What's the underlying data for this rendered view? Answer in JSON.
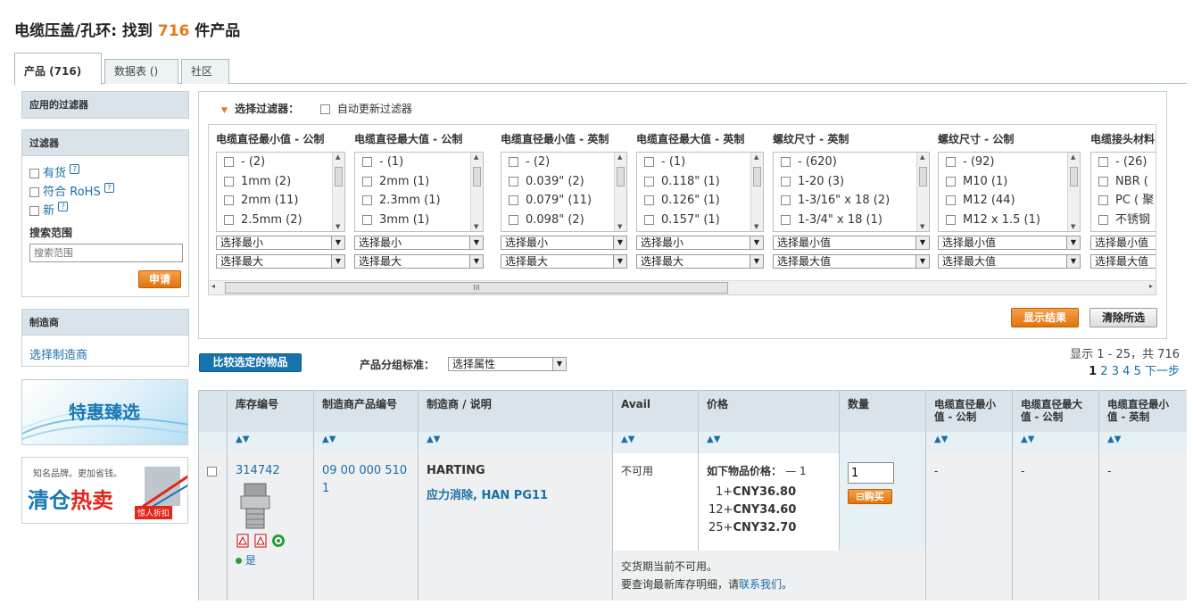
{
  "page": {
    "title_prefix": "电缆压盖/孔环: 找到",
    "title_count": "716",
    "title_suffix": "件产品"
  },
  "tabs": [
    {
      "label": "产品 (716)"
    },
    {
      "label": "数据表 ()"
    },
    {
      "label": "社区"
    }
  ],
  "sidebar": {
    "applied_filters": "应用的过滤器",
    "filters_title": "过滤器",
    "checkboxes": [
      {
        "label": "有货"
      },
      {
        "label": "符合 RoHS"
      },
      {
        "label": "新"
      }
    ],
    "search_range_label": "搜索范围",
    "search_placeholder": "搜索范围",
    "apply_button": "申请",
    "manufacturer_title": "制造商",
    "select_manufacturer": "选择制造商",
    "banner1_text": "特惠臻选",
    "banner2_small": "知名品牌。更加省钱。",
    "banner2_big1": "清仓",
    "banner2_big2": "热卖",
    "banner2_tag": "惊人折扣"
  },
  "filter_panel": {
    "select_filter_label": "选择过滤器：",
    "auto_update_label": "自动更新过滤器",
    "scroll_grip": "III",
    "columns": [
      {
        "header": "电缆直径最小值 - 公制",
        "items": [
          "- (2)",
          "1mm (2)",
          "2mm (11)",
          "2.5mm (2)"
        ],
        "min": "选择最小",
        "max": "选择最大"
      },
      {
        "header": "电缆直径最大值 - 公制",
        "items": [
          "- (1)",
          "2mm (1)",
          "2.3mm (1)",
          "3mm (1)"
        ],
        "min": "选择最小",
        "max": "选择最大"
      },
      {
        "header": "电缆直径最小值 - 英制",
        "items": [
          "- (2)",
          "0.039\" (2)",
          "0.079\" (11)",
          "0.098\" (2)"
        ],
        "min": "选择最小",
        "max": "选择最大"
      },
      {
        "header": "电缆直径最大值 - 英制",
        "items": [
          "- (1)",
          "0.118\" (1)",
          "0.126\" (1)",
          "0.157\" (1)"
        ],
        "min": "选择最小",
        "max": "选择最大"
      },
      {
        "header": "螺纹尺寸 - 英制",
        "items": [
          "- (620)",
          "1-20 (3)",
          "1-3/16\" x 18 (2)",
          "1-3/4\" x 18 (1)"
        ],
        "min": "选择最小值",
        "max": "选择最大值"
      },
      {
        "header": "螺纹尺寸 - 公制",
        "items": [
          "- (92)",
          "M10 (1)",
          "M12 (44)",
          "M12 x 1.5 (1)"
        ],
        "min": "选择最小值",
        "max": "选择最大值"
      },
      {
        "header": "电缆接头材料",
        "items": [
          "- (26)",
          "NBR ( ",
          "PC ( 聚",
          "不锈钢"
        ],
        "min": "选择最小值",
        "max": "选择最大值"
      }
    ],
    "show_results": "显示结果",
    "clear_selection": "清除所选"
  },
  "toolbar": {
    "compare_button": "比较选定的物品",
    "group_label": "产品分组标准：",
    "group_select": "选择属性",
    "display_info": "显示 1 - 25，共 716",
    "pages": [
      "1",
      "2",
      "3",
      "4",
      "5"
    ],
    "next_label": "下一步"
  },
  "table": {
    "headers": [
      "库存编号",
      "制造商产品编号",
      "制造商 / 说明",
      "Avail",
      "价格",
      "数量",
      "电缆直径最小值 - 公制",
      "电缆直径最大值 - 公制",
      "电缆直径最小值 - 英制"
    ],
    "sort_arrows": "▲▼",
    "row": {
      "stock_no": "314742",
      "mfr_part_no": "09 00 000 5101",
      "manufacturer": "HARTING",
      "description": "应力消除, HAN PG11",
      "avail": "不可用",
      "price_label": "如下物品价格：",
      "price_qty": "— 1",
      "prices": [
        {
          "qty": "1+",
          "price": "CNY36.80"
        },
        {
          "qty": "12+",
          "price": "CNY34.60"
        },
        {
          "qty": "25+",
          "price": "CNY32.70"
        }
      ],
      "quantity_value": "1",
      "buy_button": "购买",
      "rohs_label": "是",
      "delivery_note": "交货期当前不可用。",
      "contact_prefix": "要查询最新库存明细，请",
      "contact_link": "联系我们",
      "contact_suffix": "。",
      "dash1": "-",
      "dash2": "-",
      "dash3": "-"
    }
  },
  "colors": {
    "accent_orange": "#e47a1a",
    "link_blue": "#1a6fa8",
    "header_bg": "#d9e3e9",
    "compare_button_bg": "#1773ac"
  }
}
